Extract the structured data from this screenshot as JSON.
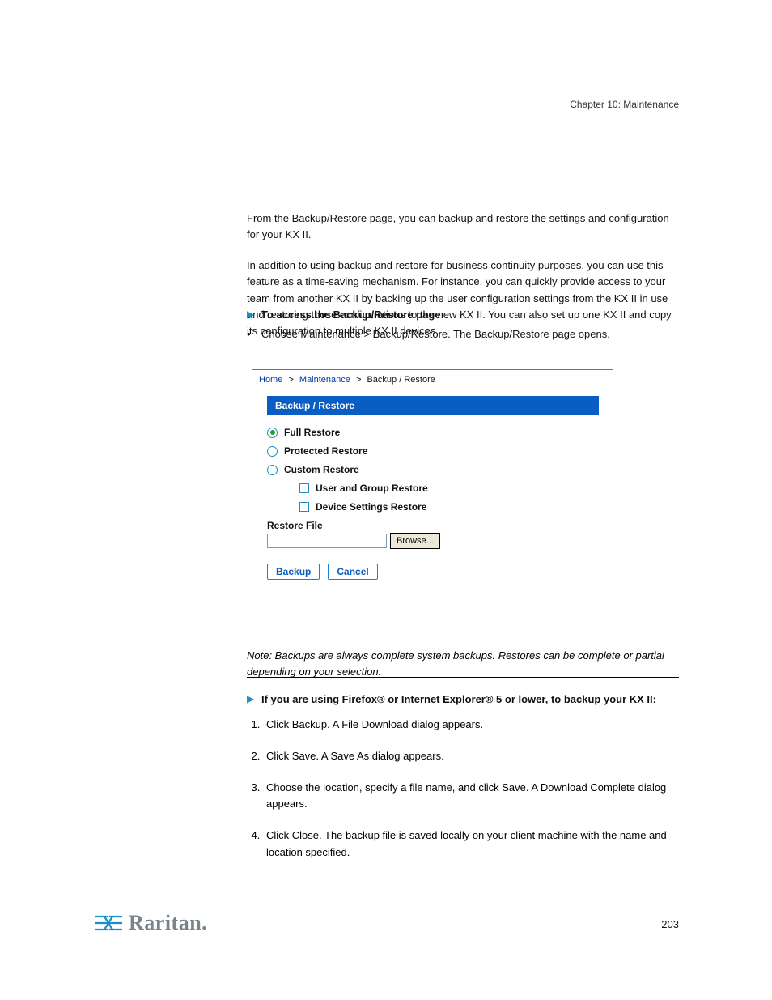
{
  "header": {
    "chapter": "Chapter 10: Maintenance"
  },
  "body": {
    "p1": "From the Backup/Restore page, you can backup and restore the settings and configuration for your KX II.",
    "p2": "In addition to using backup and restore for business continuity purposes, you can use this feature as a time-saving mechanism. For instance, you can quickly provide access to your team from another KX II by backing up the user configuration settings from the KX II in use and restoring those configurations to the new KX II. You can also set up one KX II and copy its configuration to multiple KX II devices."
  },
  "instr1": {
    "heading": "To access the Backup/Restore page:",
    "bullet": "Choose Maintenance > Backup/Restore. The Backup/Restore page opens."
  },
  "breadcrumb": {
    "home": "Home",
    "maintenance": "Maintenance",
    "current": "Backup / Restore"
  },
  "panel": {
    "title": "Backup / Restore",
    "full": "Full Restore",
    "protected": "Protected Restore",
    "custom": "Custom Restore",
    "user_group": "User and Group Restore",
    "device": "Device Settings Restore",
    "restore_file": "Restore File",
    "browse": "Browse...",
    "backup_btn": "Backup",
    "cancel_btn": "Cancel"
  },
  "note": {
    "text": "Note: Backups are always complete system backups. Restores can be complete or partial depending on your selection."
  },
  "instr2": {
    "heading": "If you are using Firefox® or Internet Explorer® 5 or lower, to backup your KX II:"
  },
  "steps": {
    "s1": "Click Backup. A File Download dialog appears.",
    "s2": "Click Save. A Save As dialog appears.",
    "s3": "Choose the location, specify a file name, and click Save. A Download Complete dialog appears.",
    "s4": "Click Close. The backup file is saved locally on your client machine with the name and location specified."
  },
  "footer": {
    "brand": "Raritan.",
    "page": "203"
  }
}
